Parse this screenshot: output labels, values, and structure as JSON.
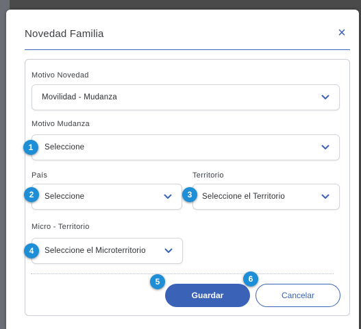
{
  "modal": {
    "title": "Novedad Familia",
    "close_symbol": "×"
  },
  "form": {
    "motivo_novedad": {
      "label": "Motivo Novedad",
      "value": "Movilidad - Mudanza"
    },
    "motivo_mudanza": {
      "label": "Motivo Mudanza",
      "value": "Seleccione"
    },
    "pais": {
      "label": "País",
      "value": "Seleccione"
    },
    "territorio": {
      "label": "Territorio",
      "value": "Seleccione el Territorio"
    },
    "micro_territorio": {
      "label": "Micro - Territorio",
      "value": "Seleccione el Microterritorio"
    }
  },
  "badges": [
    "1",
    "2",
    "3",
    "4",
    "5",
    "6"
  ],
  "buttons": {
    "save": "Guardar",
    "cancel": "Cancelar"
  },
  "colors": {
    "primary": "#3a62b7",
    "badge": "#1e8fd6"
  },
  "icons": {
    "close": "close-icon",
    "chevron": "chevron-down-icon"
  }
}
